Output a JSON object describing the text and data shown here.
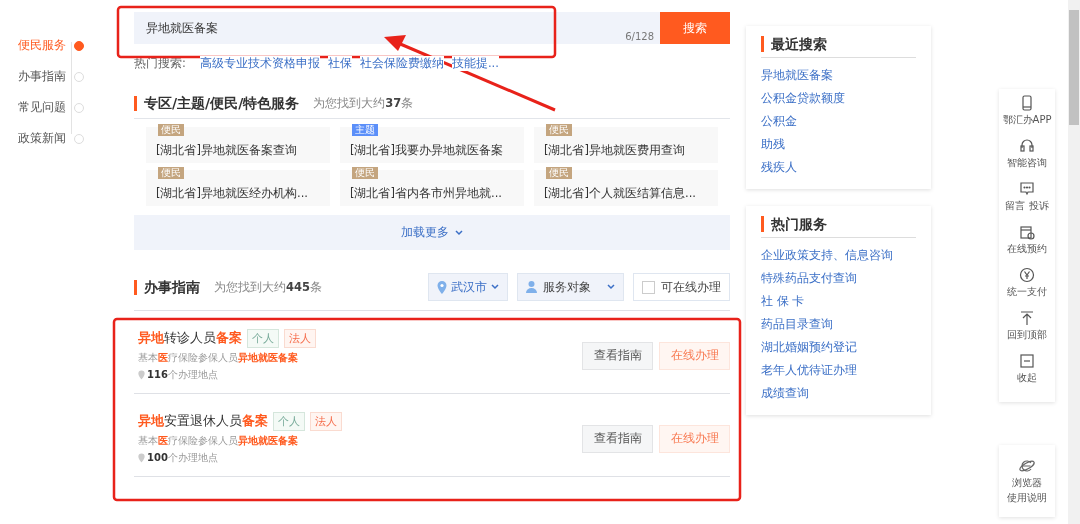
{
  "side_nav": [
    {
      "label": "便民服务",
      "selected": true
    },
    {
      "label": "办事指南",
      "selected": false
    },
    {
      "label": "常见问题",
      "selected": false
    },
    {
      "label": "政策新闻",
      "selected": false
    }
  ],
  "search": {
    "value": "异地就医备案",
    "counter": "6/128",
    "button": "搜索"
  },
  "hot_search": {
    "label": "热门搜索:",
    "links": [
      "高级专业技术资格申报",
      "社保",
      "社会保险费缴纳",
      "技能提..."
    ]
  },
  "special_section": {
    "title": "专区/主题/便民/特色服务",
    "count": "为您找到大约**37**条",
    "items": [
      {
        "tag": "便民",
        "color": "#c4a57f",
        "title": "[湖北省]异地就医备案查询"
      },
      {
        "tag": "主题",
        "color": "#5b8ff9",
        "title": "[湖北省]我要办异地就医备案"
      },
      {
        "tag": "便民",
        "color": "#c4a57f",
        "title": "[湖北省]异地就医费用查询"
      },
      {
        "tag": "便民",
        "color": "#c4a57f",
        "title": "[湖北省]异地就医经办机构..."
      },
      {
        "tag": "便民",
        "color": "#c4a57f",
        "title": "[湖北省]省内各市州异地就..."
      },
      {
        "tag": "便民",
        "color": "#c4a57f",
        "title": "[湖北省]个人就医结算信息..."
      }
    ],
    "load_more": "加载更多"
  },
  "guide_section": {
    "title": "办事指南",
    "count": "为您找到大约**445**条",
    "city": "武汉市",
    "audience": "服务对象",
    "online_filter": {
      "label": "可在线办理",
      "checked": false
    },
    "results": [
      {
        "title": "**异地**转诊人员**备案**",
        "tags": [
          "个人",
          "法人"
        ],
        "description": "基本**医**疗保险参保人员**异地就医备案**",
        "locations": "**116**个办理地点",
        "guide_button": "查看指南",
        "online_button": "在线办理"
      },
      {
        "title": "**异地**安置退休人员**备案**",
        "tags": [
          "个人",
          "法人"
        ],
        "description": "基本**医**疗保险参保人员**异地就医备案**",
        "locations": "**100**个办理地点",
        "guide_button": "查看指南",
        "online_button": "在线办理"
      }
    ]
  },
  "recent_searches": {
    "title": "最近搜索",
    "items": [
      "异地就医备案",
      "公积金贷款额度",
      "公积金",
      "助残",
      "残疾人"
    ]
  },
  "hot_services": {
    "title": "热门服务",
    "items": [
      "企业政策支持、信息咨询",
      "特殊药品支付查询",
      "社 保 卡",
      "药品目录查询",
      "湖北婚姻预约登记",
      "老年人优待证办理",
      "成绩查询"
    ]
  },
  "float_toolbar": [
    {
      "kind": "phone",
      "label": "鄂汇办APP"
    },
    {
      "kind": "headset",
      "label": "智能咨询"
    },
    {
      "kind": "message",
      "label": "留言 投诉"
    },
    {
      "kind": "calendar",
      "label": "在线预约"
    },
    {
      "kind": "yen",
      "label": "统一支付"
    },
    {
      "kind": "top",
      "label": "回到顶部"
    },
    {
      "kind": "collapse",
      "label": "收起"
    }
  ],
  "browser_help": {
    "lines": [
      "浏览器",
      "使用说明"
    ]
  }
}
